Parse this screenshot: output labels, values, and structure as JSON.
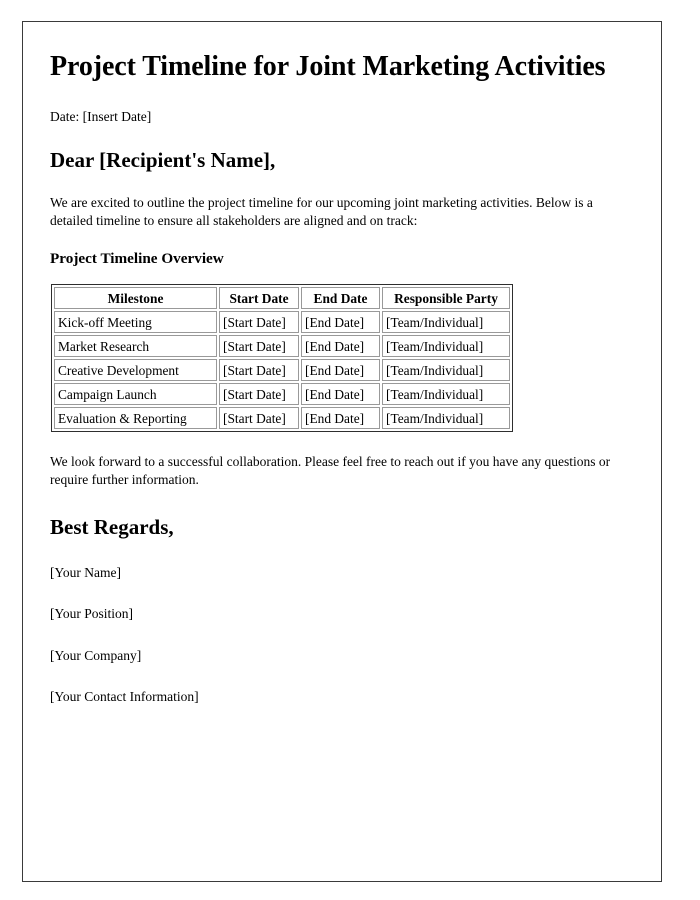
{
  "document": {
    "title": "Project Timeline for Joint Marketing Activities",
    "date_line": "Date: [Insert Date]",
    "salutation": "Dear [Recipient's Name],",
    "intro_paragraph": "We are excited to outline the project timeline for our upcoming joint marketing activities. Below is a detailed timeline to ensure all stakeholders are aligned and on track:",
    "section_heading": "Project Timeline Overview",
    "closing_paragraph": "We look forward to a successful collaboration. Please feel free to reach out if you have any questions or require further information.",
    "sign_off": "Best Regards,",
    "signature": {
      "name": "[Your Name]",
      "position": "[Your Position]",
      "company": "[Your Company]",
      "contact": "[Your Contact Information]"
    }
  },
  "table": {
    "headers": [
      "Milestone",
      "Start Date",
      "End Date",
      "Responsible Party"
    ],
    "rows": [
      {
        "milestone": "Kick-off Meeting",
        "start_date": "[Start Date]",
        "end_date": "[End Date]",
        "responsible_party": "[Team/Individual]"
      },
      {
        "milestone": "Market Research",
        "start_date": "[Start Date]",
        "end_date": "[End Date]",
        "responsible_party": "[Team/Individual]"
      },
      {
        "milestone": "Creative Development",
        "start_date": "[Start Date]",
        "end_date": "[End Date]",
        "responsible_party": "[Team/Individual]"
      },
      {
        "milestone": "Campaign Launch",
        "start_date": "[Start Date]",
        "end_date": "[End Date]",
        "responsible_party": "[Team/Individual]"
      },
      {
        "milestone": "Evaluation & Reporting",
        "start_date": "[Start Date]",
        "end_date": "[End Date]",
        "responsible_party": "[Team/Individual]"
      }
    ]
  },
  "colors": {
    "page_background": "#ffffff",
    "text": "#000000",
    "page_border": "#3a3a3a",
    "table_outer_border": "#2e2e2e",
    "table_cell_border": "#999999"
  }
}
